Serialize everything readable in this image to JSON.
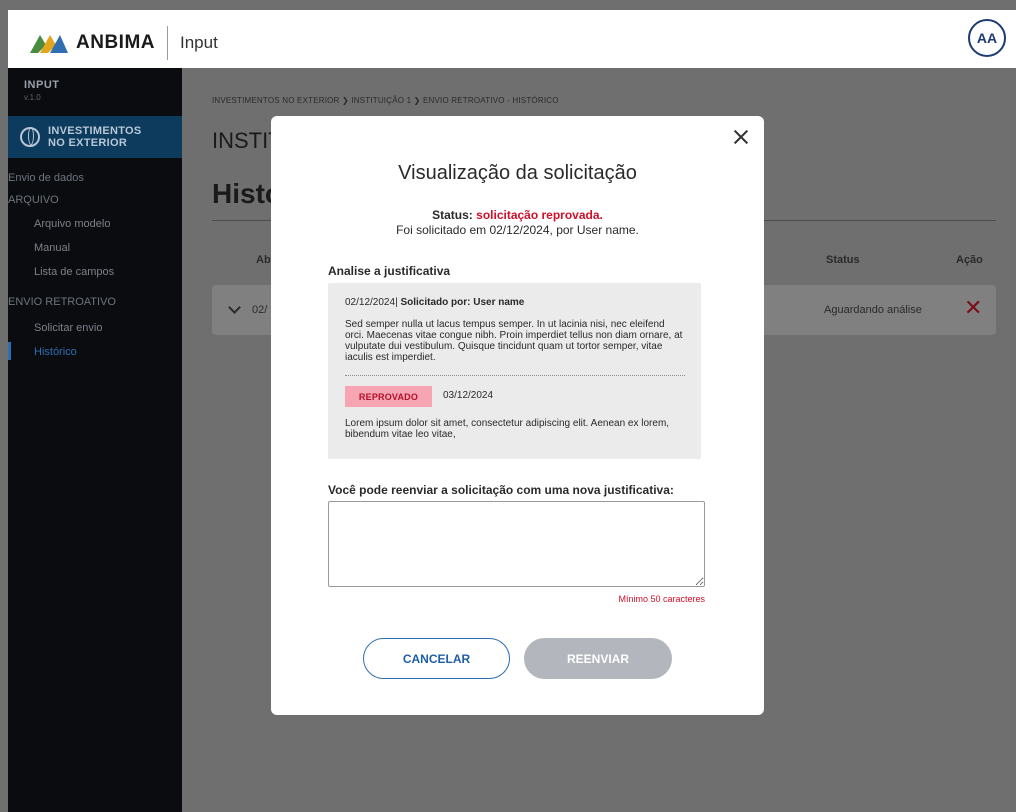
{
  "topbar": {
    "brand": "ANBIMA",
    "app_name": "Input",
    "avatar_initials": "AA",
    "brand_colors": [
      "#4a8b3f",
      "#e3a51c",
      "#2f6fb1"
    ]
  },
  "sidebar": {
    "title": "INPUT",
    "version": "v.1.0",
    "module_line1": "INVESTIMENTOS",
    "module_line2": "NO EXTERIOR",
    "items": [
      {
        "label": "Envio de dados"
      },
      {
        "label": "ARQUIVO"
      },
      {
        "label": "Arquivo modelo"
      },
      {
        "label": "Manual"
      },
      {
        "label": "Lista de campos"
      },
      {
        "label": "ENVIO RETROATIVO"
      },
      {
        "label": "Solicitar envio"
      },
      {
        "label": "Histórico"
      }
    ]
  },
  "page": {
    "breadcrumb": "INVESTIMENTOS NO EXTERIOR  ❯  INSTITUIÇÃO 1  ❯  ENVIO RETROATIVO - HISTÓRICO",
    "heading": "INSTIT",
    "subheading": "Histó",
    "columns": {
      "opened": "Abe",
      "status": "Status",
      "action": "Ação"
    },
    "row": {
      "date": "02/",
      "status": "Aguardando análise"
    }
  },
  "modal": {
    "title": "Visualização da solicitação",
    "status_label": "Status:",
    "status_value": "solicitação reprovada.",
    "requested_text": "Foi solicitado em 02/12/2024, por User name.",
    "section_label": "Analise a justificativa",
    "justification": {
      "date": "02/12/2024",
      "requested_by_label": "Solicitado por: User name",
      "text": "Sed semper nulla ut lacus tempus semper. In ut lacinia nisi, nec eleifend orci. Maecenas vitae congue nibh. Proin imperdiet tellus non diam ornare, at vulputate dui vestibulum. Quisque tincidunt quam ut tortor semper, vitae iaculis est imperdiet.",
      "badge": "REPROVADO",
      "badge_date": "03/12/2024",
      "reply": "Lorem ipsum dolor sit amet, consectetur adipiscing elit. Aenean ex lorem, bibendum vitae leo vitae,"
    },
    "new_justification_label": "Você pode reenviar a solicitação com uma nova justificativa:",
    "new_justification_value": "",
    "min_chars_hint": "Mínimo 50 caracteres",
    "cancel_label": "CANCELAR",
    "resend_label": "REENVIAR",
    "colors": {
      "error": "#d0102a",
      "badge_bg": "#f8a5b3",
      "primary": "#1f5ea8",
      "disabled": "#b3b6bd"
    }
  }
}
